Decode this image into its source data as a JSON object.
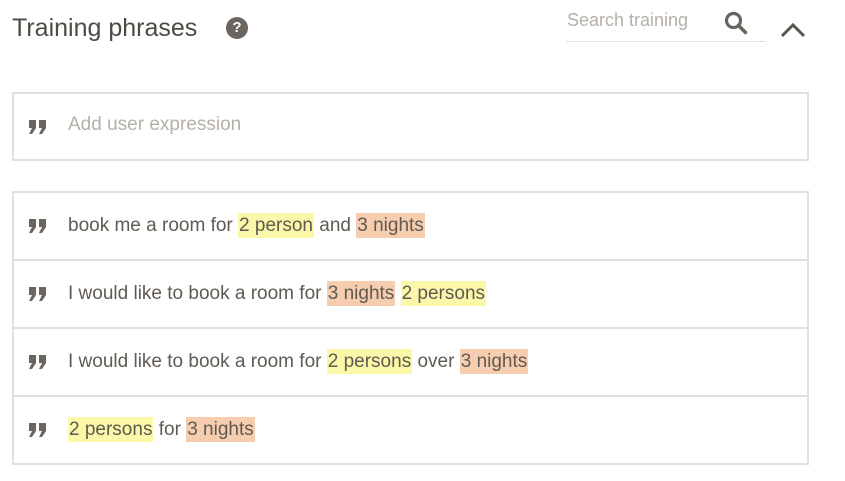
{
  "header": {
    "title": "Training phrases",
    "help_glyph": "?"
  },
  "search": {
    "placeholder": "Search training"
  },
  "add_expression": {
    "placeholder": "Add user expression"
  },
  "colors": {
    "param_person": "#fbf8a9",
    "param_nights": "#f7cdb0",
    "border": "#e3e0db",
    "icon": "#6b6560"
  },
  "icons": [
    "help-icon",
    "search-icon",
    "chevron-up-icon",
    "quote-icon"
  ],
  "phrases": [
    {
      "seg1": "book me a room for ",
      "p1": "2 person",
      "seg2": " and ",
      "p2": "3 nights"
    },
    {
      "seg1": "I would like to book a room for ",
      "p1": "3 nights",
      "seg2": " ",
      "p2": "2 persons"
    },
    {
      "seg1": "I would like to book a room for ",
      "p1": "2 persons",
      "seg2": " over ",
      "p2": "3 nights"
    },
    {
      "seg1": "",
      "p1": "2 persons",
      "seg2": " for ",
      "p2": "3 nights"
    }
  ]
}
